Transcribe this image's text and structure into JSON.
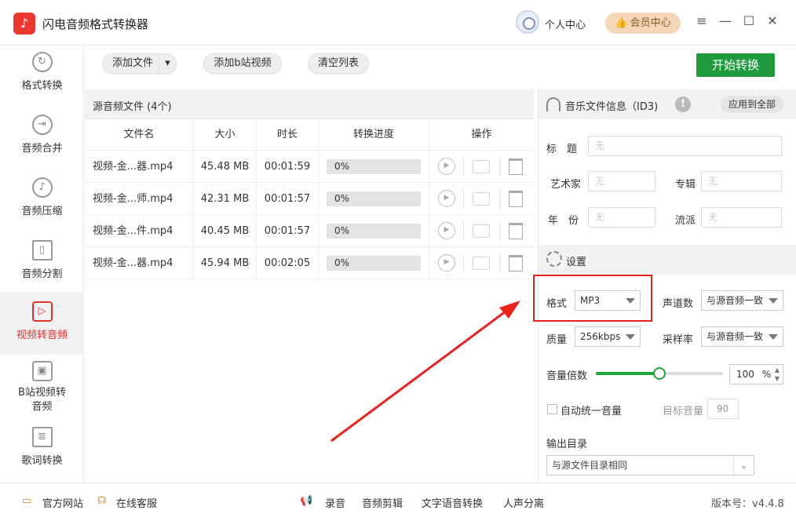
{
  "app": {
    "title": "闪电音频格式转换器",
    "logo_icon": "music-note-icon"
  },
  "header": {
    "user_center": "个人中心",
    "vip_center": "会员中心",
    "menu_icon": "≡",
    "minimize_icon": "—",
    "maximize_icon": "☐",
    "close_icon": "✕"
  },
  "sidebar": {
    "items": [
      {
        "label": "格式转换",
        "icon": "↻"
      },
      {
        "label": "音频合并",
        "icon": "⇥"
      },
      {
        "label": "音频压缩",
        "icon": "♪"
      },
      {
        "label": "音频分割",
        "icon": "▯"
      },
      {
        "label": "视频转音频",
        "icon": "▷"
      },
      {
        "label_line1": "B站视频转",
        "label_line2": "音频",
        "icon": "▣"
      },
      {
        "label": "歌词转换",
        "icon": "≣"
      }
    ]
  },
  "toolbar": {
    "add_file": "添加文件",
    "add_dropdown": "▾",
    "add_bilibili": "添加b站视频",
    "clear_list": "清空列表",
    "start": "开始转换"
  },
  "files": {
    "header": "源音频文件 (4个)",
    "columns": [
      "文件名",
      "大小",
      "时长",
      "转换进度",
      "操作"
    ],
    "rows": [
      {
        "name": "视频-金...器.mp4",
        "size": "45.48 MB",
        "duration": "00:01:59",
        "progress": "0%"
      },
      {
        "name": "视频-金...师.mp4",
        "size": "42.31 MB",
        "duration": "00:01:57",
        "progress": "0%"
      },
      {
        "name": "视频-金...件.mp4",
        "size": "40.45 MB",
        "duration": "00:01:57",
        "progress": "0%"
      },
      {
        "name": "视频-金...器.mp4",
        "size": "45.94 MB",
        "duration": "00:02:05",
        "progress": "0%"
      }
    ]
  },
  "id3": {
    "title": "音乐文件信息（ID3)",
    "apply_all": "应用到全部",
    "fields": {
      "title_label": "标　题",
      "artist_label": "艺术家",
      "album_label": "专辑",
      "year_label": "年　份",
      "genre_label": "流派",
      "placeholder": "无"
    }
  },
  "settings": {
    "title": "设置",
    "format_label": "格式",
    "format_value": "MP3",
    "channels_label": "声道数",
    "channels_value": "与源音频一致",
    "quality_label": "质量",
    "quality_value": "256kbps",
    "samplerate_label": "采样率",
    "samplerate_value": "与源音频一致",
    "volume_label": "音量倍数",
    "volume_value": "100",
    "volume_unit": "%",
    "volume_level": 0.5,
    "auto_volume_label": "自动统一音量",
    "target_volume_label": "目标音量",
    "target_volume_value": "90",
    "output_label": "输出目录",
    "output_value": "与源文件目录相同"
  },
  "bottom": {
    "website": "官方网站",
    "support": "在线客服",
    "record": "录音",
    "audio_edit": "音频剪辑",
    "tts": "文字语音转换",
    "vocal_split": "人声分离",
    "version": "版本号：v4.4.8"
  },
  "colors": {
    "accent_red": "#e0302d",
    "start_green": "#1f9b3e",
    "slider_green": "#22a33c",
    "vip_bg": "#f4d7b7"
  }
}
